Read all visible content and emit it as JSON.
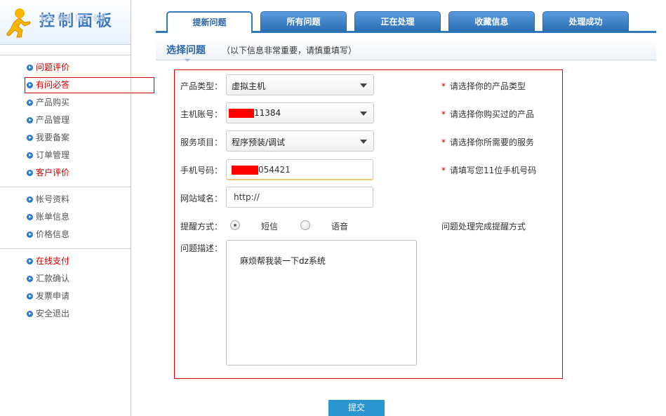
{
  "sidebar": {
    "title": "控制面板",
    "groups": [
      [
        {
          "label": "问题评价",
          "red": true
        },
        {
          "label": "有问必答",
          "red": true
        },
        {
          "label": "产品购买",
          "red": false
        },
        {
          "label": "产品管理",
          "red": false
        },
        {
          "label": "我要备案",
          "red": false
        },
        {
          "label": "订单管理",
          "red": false
        },
        {
          "label": "客户评价",
          "red": true
        }
      ],
      [
        {
          "label": "帐号资料",
          "red": false
        },
        {
          "label": "账单信息",
          "red": false
        },
        {
          "label": "价格信息",
          "red": false
        }
      ],
      [
        {
          "label": "在线支付",
          "red": true
        },
        {
          "label": "汇款确认",
          "red": false
        },
        {
          "label": "发票申请",
          "red": false
        },
        {
          "label": "安全退出",
          "red": false
        }
      ]
    ]
  },
  "tabs": [
    "提新问题",
    "所有问题",
    "正在处理",
    "收藏信息",
    "处理成功"
  ],
  "section": {
    "title": "选择问题",
    "note": "（以下信息非常重要，请慎重填写）"
  },
  "form": {
    "product_type": {
      "label": "产品类型：",
      "value": "虚拟主机",
      "hint": "请选择你的产品类型"
    },
    "host_account": {
      "label": "主机账号：",
      "value": "11384",
      "hint": "请选择你购买过的产品"
    },
    "service": {
      "label": "服务项目：",
      "value": "程序预装/调试",
      "hint": "请选择你所需要的服务"
    },
    "phone": {
      "label": "手机号码：",
      "value": "054421",
      "hint": "请填写您11位手机号码"
    },
    "domain": {
      "label": "网站域名：",
      "value": "http://"
    },
    "remind": {
      "label": "提醒方式：",
      "option1": "短信",
      "option2": "语音",
      "hint": "问题处理完成提醒方式"
    },
    "description": {
      "label": "问题描述：",
      "value": "麻烦帮我装一下dz系统"
    },
    "submit": "提交"
  },
  "colors": {
    "accent": "#2f79bd",
    "alert": "#d40000"
  }
}
